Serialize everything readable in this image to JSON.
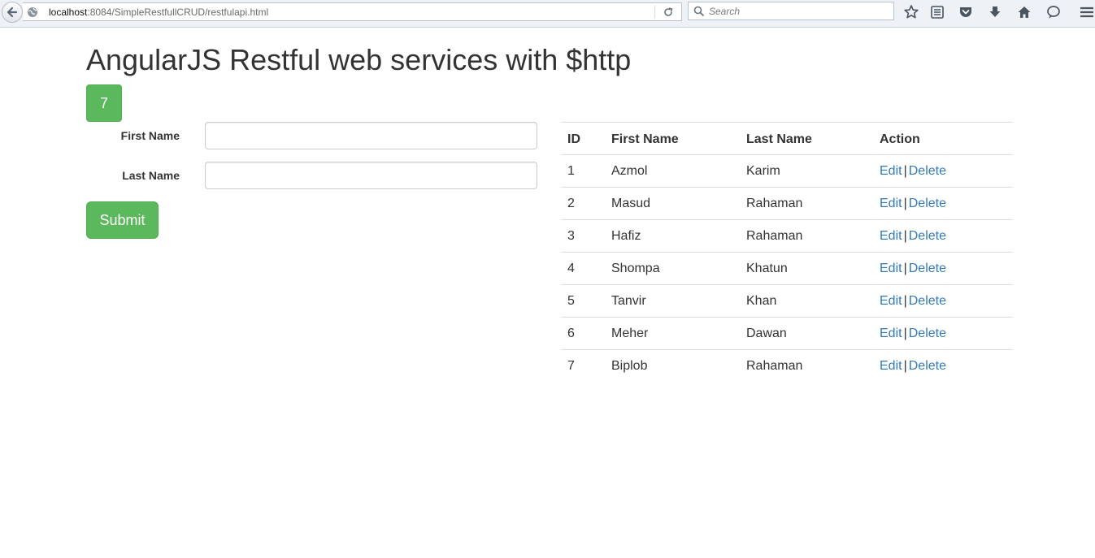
{
  "browser": {
    "url_host": "localhost",
    "url_rest": ":8084/SimpleRestfullCRUD/restfulapi.html",
    "search_placeholder": "Search"
  },
  "page": {
    "title": "AngularJS Restful web services with $http",
    "count": "7"
  },
  "form": {
    "first_name_label": "First Name",
    "first_name_value": "",
    "last_name_label": "Last Name",
    "last_name_value": "",
    "submit_label": "Submit"
  },
  "table": {
    "headers": [
      "ID",
      "First Name",
      "Last Name",
      "Action"
    ],
    "edit_label": "Edit",
    "delete_label": "Delete",
    "separator": "|",
    "rows": [
      {
        "id": "1",
        "first": "Azmol",
        "last": "Karim"
      },
      {
        "id": "2",
        "first": "Masud",
        "last": "Rahaman"
      },
      {
        "id": "3",
        "first": "Hafiz",
        "last": "Rahaman"
      },
      {
        "id": "4",
        "first": "Shompa",
        "last": "Khatun"
      },
      {
        "id": "5",
        "first": "Tanvir",
        "last": "Khan"
      },
      {
        "id": "6",
        "first": "Meher",
        "last": "Dawan"
      },
      {
        "id": "7",
        "first": "Biplob",
        "last": "Rahaman"
      }
    ]
  },
  "colors": {
    "success": "#5cb85c",
    "link": "#337ab7",
    "text": "#333333"
  },
  "icons": [
    "back-arrow-icon",
    "globe-icon",
    "reload-icon",
    "search-icon",
    "bookmark-star-icon",
    "reading-list-icon",
    "pocket-icon",
    "download-icon",
    "home-icon",
    "chat-icon",
    "menu-icon"
  ]
}
